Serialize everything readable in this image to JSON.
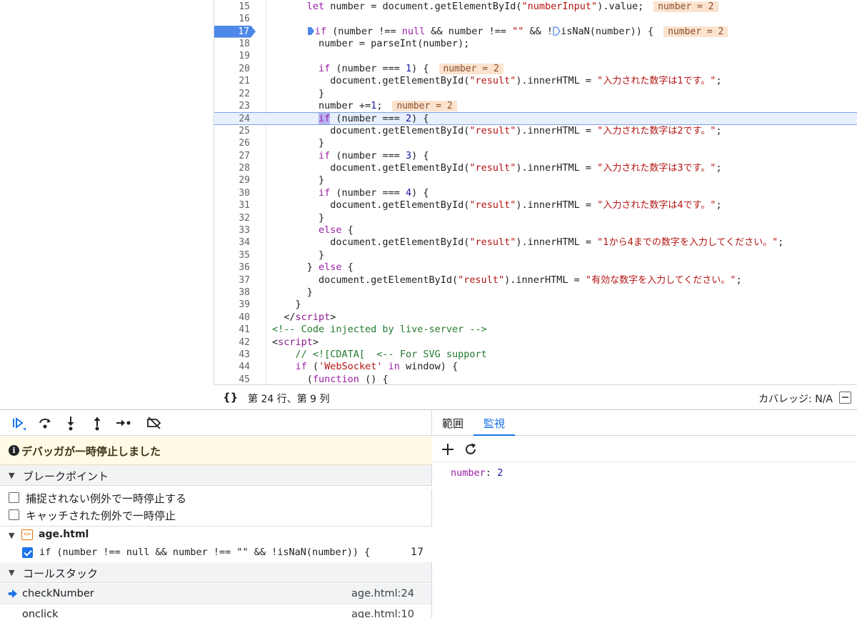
{
  "editor": {
    "lines": [
      {
        "n": "15",
        "html": "      <span class=\"kw\">let</span> number = document.getElementById(<span class=\"str\">\"numberInput\"</span>).value;<span class=\"inl\">number = 2</span>"
      },
      {
        "n": "16",
        "html": ""
      },
      {
        "n": "17",
        "bp": true,
        "html": "      <svg class=\"bpmark\" viewBox=\"0 0 11 13\"><path d=\"M1 1 H6 L10 6.5 L6 12 H1 Z\" fill=\"#4d88e8\"/></svg><span class=\"kw\">if</span> (number !== <span class=\"kw\">null</span> &amp;&amp; number !== <span class=\"str\">\"\"</span> &amp;&amp; !<svg class=\"bpmark\" viewBox=\"0 0 11 13\"><path d=\"M1 1 H6 L10 6.5 L6 12 H1 Z\" fill=\"none\" stroke=\"#4d88e8\" stroke-width=\"1.3\"/></svg>isNaN(number)) {<span class=\"inl\">number = 2</span>"
      },
      {
        "n": "18",
        "html": "        number = parseInt(number);"
      },
      {
        "n": "19",
        "html": ""
      },
      {
        "n": "20",
        "html": "        <span class=\"kw\">if</span> (number === <span class=\"num\">1</span>) {<span class=\"inl\">number = 2</span>"
      },
      {
        "n": "21",
        "html": "          document.getElementById(<span class=\"str\">\"result\"</span>).innerHTML = <span class=\"str\">\"<span class=\"jp\">入力された数字は1です。</span>\"</span>;"
      },
      {
        "n": "22",
        "html": "        }"
      },
      {
        "n": "23",
        "html": "        number +=<span class=\"num\">1</span>;<span class=\"inl\">number = 2</span>"
      },
      {
        "n": "24",
        "current": true,
        "html": "        <span class=\"kw hl\">if</span> (number === <span class=\"num\">2</span>) {"
      },
      {
        "n": "25",
        "html": "          document.getElementById(<span class=\"str\">\"result\"</span>).innerHTML = <span class=\"str\">\"<span class=\"jp\">入力された数字は2です。</span>\"</span>;"
      },
      {
        "n": "26",
        "html": "        }"
      },
      {
        "n": "27",
        "html": "        <span class=\"kw\">if</span> (number === <span class=\"num\">3</span>) {"
      },
      {
        "n": "28",
        "html": "          document.getElementById(<span class=\"str\">\"result\"</span>).innerHTML = <span class=\"str\">\"<span class=\"jp\">入力された数字は3です。</span>\"</span>;"
      },
      {
        "n": "29",
        "html": "        }"
      },
      {
        "n": "30",
        "html": "        <span class=\"kw\">if</span> (number === <span class=\"num\">4</span>) {"
      },
      {
        "n": "31",
        "html": "          document.getElementById(<span class=\"str\">\"result\"</span>).innerHTML = <span class=\"str\">\"<span class=\"jp\">入力された数字は4です。</span>\"</span>;"
      },
      {
        "n": "32",
        "html": "        }"
      },
      {
        "n": "33",
        "html": "        <span class=\"kw\">else</span> {"
      },
      {
        "n": "34",
        "html": "          document.getElementById(<span class=\"str\">\"result\"</span>).innerHTML = <span class=\"str\">\"<span class=\"jp\">1から4までの数字を入力してください。</span>\"</span>;"
      },
      {
        "n": "35",
        "html": "        }"
      },
      {
        "n": "36",
        "html": "      } <span class=\"kw\">else</span> {"
      },
      {
        "n": "37",
        "html": "        document.getElementById(<span class=\"str\">\"result\"</span>).innerHTML = <span class=\"str\">\"<span class=\"jp\">有効な数字を入力してください。</span>\"</span>;"
      },
      {
        "n": "38",
        "html": "      }"
      },
      {
        "n": "39",
        "html": "    }"
      },
      {
        "n": "40",
        "html": "  &lt;/<span class=\"tag\">script</span>&gt;"
      },
      {
        "n": "41",
        "html": "<span class=\"cm\">&lt;!-- Code injected by live-server --&gt;</span>"
      },
      {
        "n": "42",
        "html": "&lt;<span class=\"tag\">script</span>&gt;"
      },
      {
        "n": "43",
        "html": "    <span class=\"cm\">// &lt;![CDATA[  &lt;-- For SVG support</span>"
      },
      {
        "n": "44",
        "html": "    <span class=\"kw\">if</span> (<span class=\"str\">'WebSocket'</span> <span class=\"kw\">in</span> window) {"
      },
      {
        "n": "45",
        "html": "      (<span class=\"kw\">function</span> () {"
      }
    ]
  },
  "footer": {
    "braces": "{}",
    "position": "第 24 行、第 9 列",
    "coverage": "カバレッジ: N/A"
  },
  "toolbar": {
    "buttons": [
      "resume-icon",
      "step-over-icon",
      "step-into-icon",
      "step-out-icon",
      "step-icon",
      "deactivate-breakpoints-icon"
    ]
  },
  "paused": {
    "text": "デバッガが一時停止しました",
    "icon": "i"
  },
  "breakpoints": {
    "title": "ブレークポイント",
    "uncaught": "捕捉されない例外で一時停止する",
    "caught": "キャッチされた例外で一時停止",
    "file": "age.html",
    "file_icon": "<>",
    "entry_code": "if (number !== null && number !== \"\" && !isNaN(number)) {",
    "entry_line": "17"
  },
  "callstack": {
    "title": "コールスタック",
    "frames": [
      {
        "fn": "checkNumber",
        "loc": "age.html:24"
      },
      {
        "fn": "onclick",
        "loc": "age.html:10"
      }
    ]
  },
  "right": {
    "tabs": [
      "範囲",
      "監視"
    ],
    "watch_name": "number",
    "watch_sep": ":",
    "watch_value": "2"
  }
}
